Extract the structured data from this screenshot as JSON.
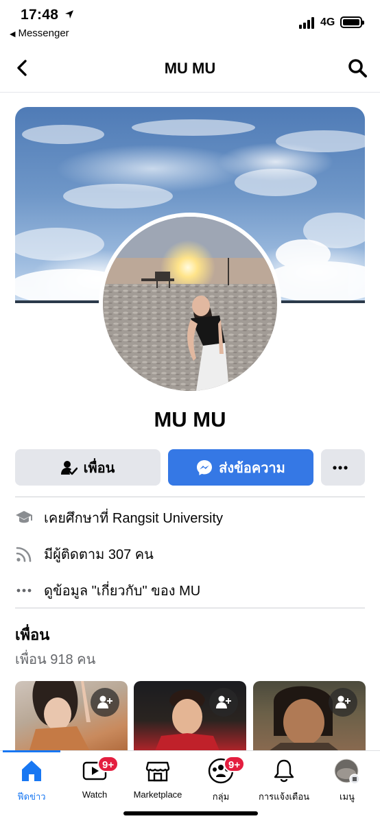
{
  "status_bar": {
    "time": "17:48",
    "back_app": "Messenger",
    "network": "4G"
  },
  "header": {
    "title": "MU MU"
  },
  "profile": {
    "name": "MU MU"
  },
  "actions": {
    "friend_label": "เพื่อน",
    "message_label": "ส่งข้อความ"
  },
  "info": {
    "education": "เคยศึกษาที่ Rangsit University",
    "followers": "มีผู้ติดตาม 307 คน",
    "about": "ดูข้อมูล \"เกี่ยวกับ\" ของ MU"
  },
  "friends": {
    "title": "เพื่อน",
    "count": "เพื่อน 918 คน"
  },
  "tabs": [
    {
      "label": "ฟีดข่าว",
      "icon": "home-icon",
      "active": true
    },
    {
      "label": "Watch",
      "icon": "watch-icon",
      "badge": "9+"
    },
    {
      "label": "Marketplace",
      "icon": "marketplace-icon"
    },
    {
      "label": "กลุ่ม",
      "icon": "groups-icon",
      "badge": "9+"
    },
    {
      "label": "การแจ้งเตือน",
      "icon": "bell-icon"
    },
    {
      "label": "เมนู",
      "icon": "menu-avatar-icon"
    }
  ],
  "colors": {
    "accent": "#1877f2",
    "message_button": "#3578e5",
    "badge": "#e41e3f",
    "secondary_button": "#e4e6eb"
  }
}
